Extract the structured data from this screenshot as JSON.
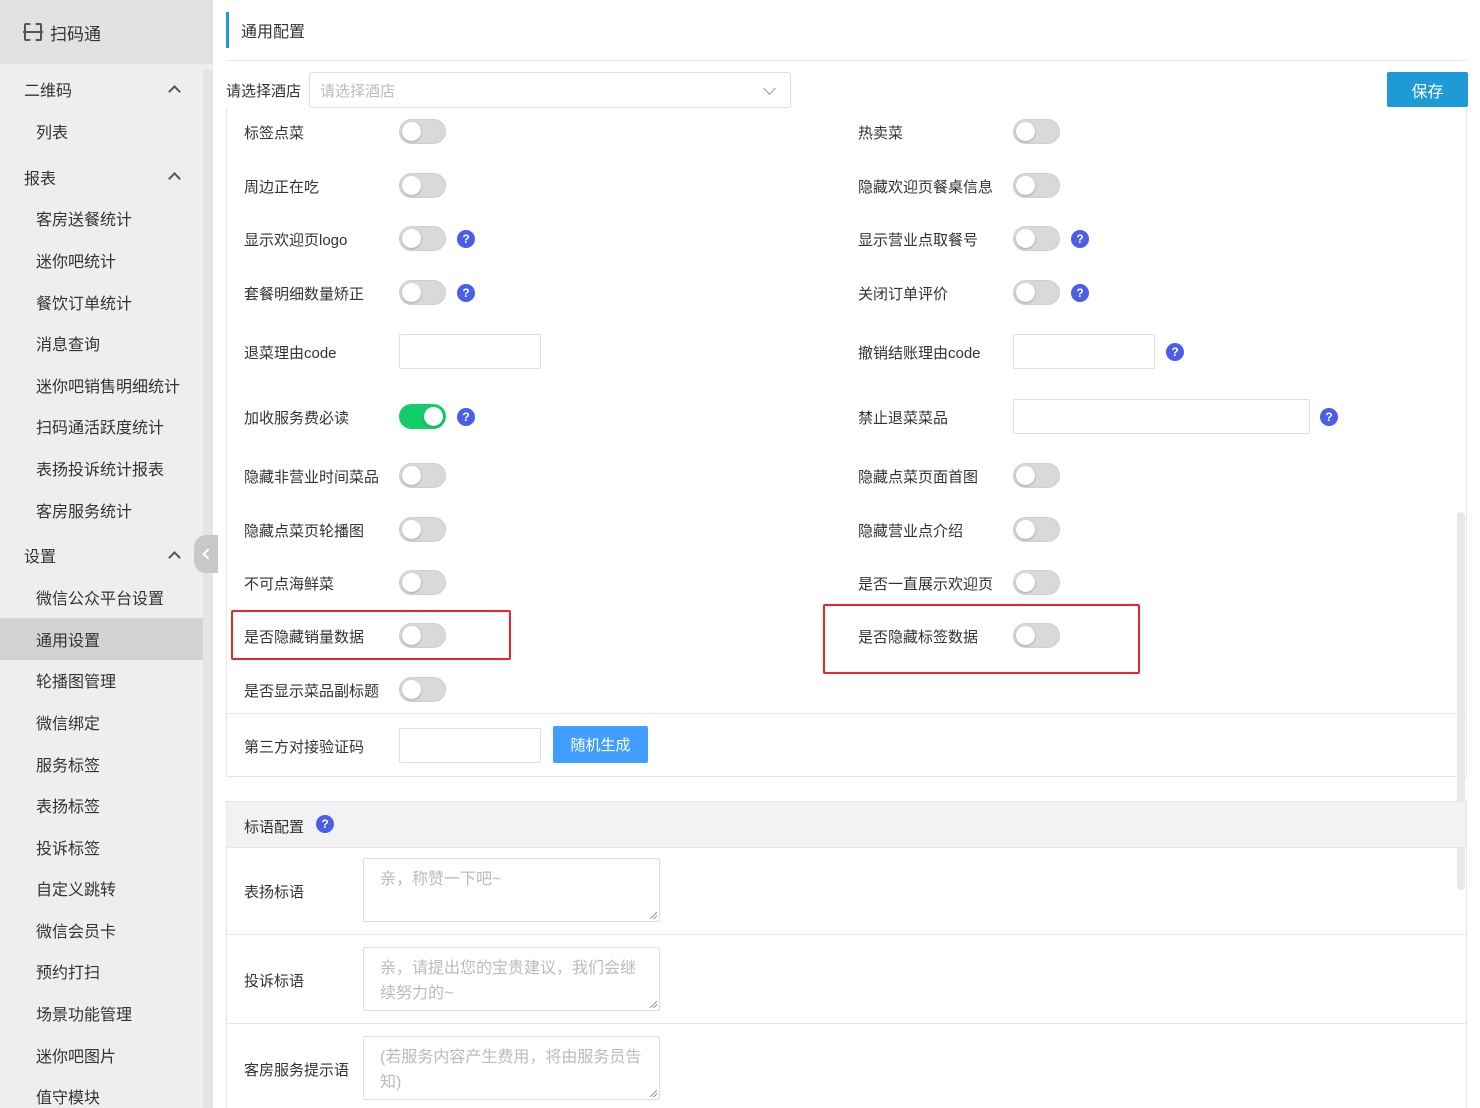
{
  "brand": {
    "title": "扫码通"
  },
  "sidebar": {
    "groups": [
      {
        "label": "二维码",
        "items": [
          "列表"
        ]
      },
      {
        "label": "报表",
        "items": [
          "客房送餐统计",
          "迷你吧统计",
          "餐饮订单统计",
          "消息查询",
          "迷你吧销售明细统计",
          "扫码通活跃度统计",
          "表扬投诉统计报表",
          "客房服务统计"
        ]
      },
      {
        "label": "设置",
        "items": [
          "微信公众平台设置",
          "通用设置",
          "轮播图管理",
          "微信绑定",
          "服务标签",
          "表扬标签",
          "投诉标签",
          "自定义跳转",
          "微信会员卡",
          "预约打扫",
          "场景功能管理",
          "迷你吧图片",
          "值守模块"
        ]
      }
    ],
    "active": "通用设置"
  },
  "page": {
    "title": "通用配置"
  },
  "hotel": {
    "label": "请选择酒店",
    "placeholder": "请选择酒店"
  },
  "save_label": "保存",
  "left_settings": [
    {
      "label": "标签点菜",
      "type": "toggle",
      "on": false,
      "help": false
    },
    {
      "label": "周边正在吃",
      "type": "toggle",
      "on": false,
      "help": false
    },
    {
      "label": "显示欢迎页logo",
      "type": "toggle",
      "on": false,
      "help": true
    },
    {
      "label": "套餐明细数量矫正",
      "type": "toggle",
      "on": false,
      "help": true
    },
    {
      "label": "退菜理由code",
      "type": "input",
      "help": false
    },
    {
      "label": "加收服务费必读",
      "type": "toggle",
      "on": true,
      "help": true
    },
    {
      "label": "隐藏非营业时间菜品",
      "type": "toggle",
      "on": false,
      "help": false
    },
    {
      "label": "隐藏点菜页轮播图",
      "type": "toggle",
      "on": false,
      "help": false
    },
    {
      "label": "不可点海鲜菜",
      "type": "toggle",
      "on": false,
      "help": false
    },
    {
      "label": "是否隐藏销量数据",
      "type": "toggle",
      "on": false,
      "help": false
    },
    {
      "label": "是否显示菜品副标题",
      "type": "toggle",
      "on": false,
      "help": false
    }
  ],
  "right_settings": [
    {
      "label": "热卖菜",
      "type": "toggle",
      "on": false,
      "help": false
    },
    {
      "label": "隐藏欢迎页餐桌信息",
      "type": "toggle",
      "on": false,
      "help": false
    },
    {
      "label": "显示营业点取餐号",
      "type": "toggle",
      "on": false,
      "help": true
    },
    {
      "label": "关闭订单评价",
      "type": "toggle",
      "on": false,
      "help": true
    },
    {
      "label": "撤销结账理由code",
      "type": "input",
      "help": true
    },
    {
      "label": "禁止退菜菜品",
      "type": "input-wide",
      "help": true
    },
    {
      "label": "隐藏点菜页面首图",
      "type": "toggle",
      "on": false,
      "help": false
    },
    {
      "label": "隐藏营业点介绍",
      "type": "toggle",
      "on": false,
      "help": false
    },
    {
      "label": "是否一直展示欢迎页",
      "type": "toggle",
      "on": false,
      "help": false
    },
    {
      "label": "是否隐藏标签数据",
      "type": "toggle",
      "on": false,
      "help": false
    }
  ],
  "third_party": {
    "label": "第三方对接验证码",
    "button": "随机生成"
  },
  "slogan": {
    "title": "标语配置",
    "rows": [
      {
        "label": "表扬标语",
        "placeholder": "亲，称赞一下吧~"
      },
      {
        "label": "投诉标语",
        "placeholder": "亲，请提出您的宝贵建议，我们会继续努力的~"
      },
      {
        "label": "客房服务提示语",
        "placeholder": "(若服务内容产生费用，将由服务员告知)"
      }
    ]
  },
  "help_glyph": "?",
  "colors": {
    "primary": "#1e9ad6",
    "toggle_on": "#13ce66",
    "help": "#4a5ee8",
    "highlight": "#e8262b"
  }
}
